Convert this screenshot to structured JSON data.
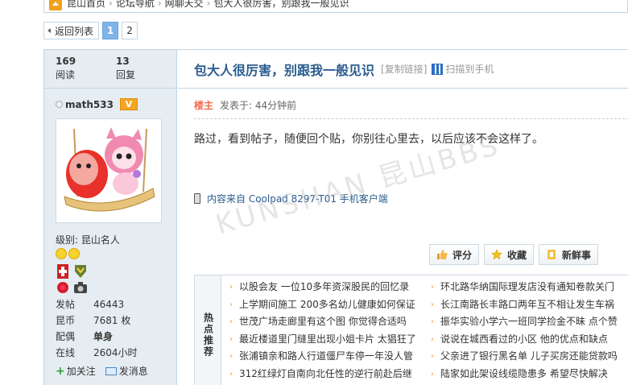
{
  "breadcrumb": [
    "昆山首页",
    "论坛导航",
    "网聊天交",
    "包大人很厉害，别跟我一般见识"
  ],
  "pager": {
    "back_label": "返回列表",
    "pages": [
      "1",
      "2"
    ],
    "current": "1"
  },
  "sidebar": {
    "views_num": "169",
    "views_label": "阅读",
    "replies_num": "13",
    "replies_label": "回复",
    "username": "math533",
    "vip_badge": "V",
    "level": "级别: 昆山名人",
    "info": [
      {
        "k": "发帖",
        "v": "46443"
      },
      {
        "k": "昆币",
        "v": "7681 枚"
      },
      {
        "k": "配偶",
        "v": "单身"
      },
      {
        "k": "在线",
        "v": "2604小时"
      }
    ],
    "follow_label": "加关注",
    "message_label": "发消息"
  },
  "thread": {
    "title": "包大人很厉害，别跟我一般见识",
    "copy_link": "[复制链接]",
    "qr_label": "扫描到手机"
  },
  "post": {
    "floor_label": "楼主",
    "time": "发表于: 44分钟前",
    "content": "路过，看到帖子，随便回个贴，你别往心里去，以后应该不会这样了。",
    "source": "内容来自 Coolpad 8297-T01 手机客户端",
    "watermark": "KUNSHAN 昆山BBS"
  },
  "buttons": {
    "rate": "评分",
    "fav": "收藏",
    "fresh": "新鲜事"
  },
  "hot": {
    "label": "热点推荐",
    "left": [
      "以股会友 一位10多年资深股民的回忆录",
      "上学期间施工 200多名幼儿健康如何保证",
      "世茂广场走廊里有这个图 你觉得合适吗",
      "最近楼道里门缝里出现小姐卡片 太猖狂了",
      "张浦镇亲和路人行道僵尸车停一年没人管",
      "312红绿灯自南向北任性的逆行前赴后继"
    ],
    "right": [
      "环北路华纳国际理发店没有通知卷款关门",
      "长江南路长丰路口两年互不相让发生车祸",
      "振华实验小学六一班同学捡金不昧 点个赞",
      "说说在城西看过的小区 他的优点和缺点",
      "父亲进了银行黑名单 儿子买房还能贷款吗",
      "陆家如此架设线缆隐患多 希望尽快解决"
    ]
  },
  "colors": {
    "accent": "#2b5c8f",
    "sidebar_bg": "#e5edf2",
    "border": "#c2d5e3"
  }
}
